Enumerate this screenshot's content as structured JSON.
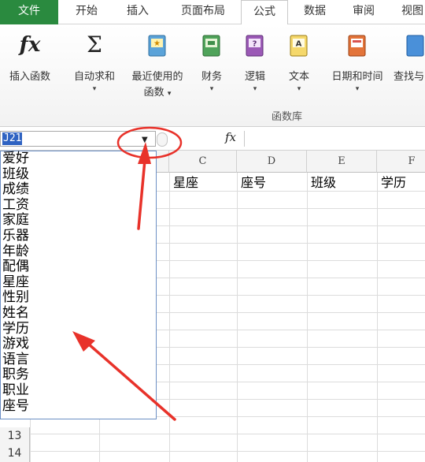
{
  "ribbon_tabs": [
    "文件",
    "开始",
    "插入",
    "页面布局",
    "公式",
    "数据",
    "审阅",
    "视图"
  ],
  "active_tab": "公式",
  "ribbon_buttons": {
    "insert_function": "插入函数",
    "autosum": "自动求和",
    "recent_line1": "最近使用的",
    "recent_line2": "函数",
    "finance": "财务",
    "logic": "逻辑",
    "text": "文本",
    "datetime": "日期和时间",
    "lookup": "查找与"
  },
  "ribbon_group_label": "函数库",
  "formula_bar": {
    "name_box_value": "J21",
    "fx_label": "fx",
    "formula_value": ""
  },
  "columns": [
    "C",
    "D",
    "E",
    "F"
  ],
  "header_cells": [
    "星座",
    "座号",
    "班级",
    "学历"
  ],
  "row_numbers": [
    "13",
    "14"
  ],
  "name_list": [
    "爱好",
    "班级",
    "成绩",
    "工资",
    "家庭",
    "乐器",
    "年龄",
    "配偶",
    "星座",
    "性别",
    "姓名",
    "学历",
    "游戏",
    "语言",
    "职务",
    "职业",
    "座号"
  ],
  "colors": {
    "file_tab": "#2a8a3f",
    "selection": "#2f63c2",
    "annotation": "#e8322a"
  }
}
